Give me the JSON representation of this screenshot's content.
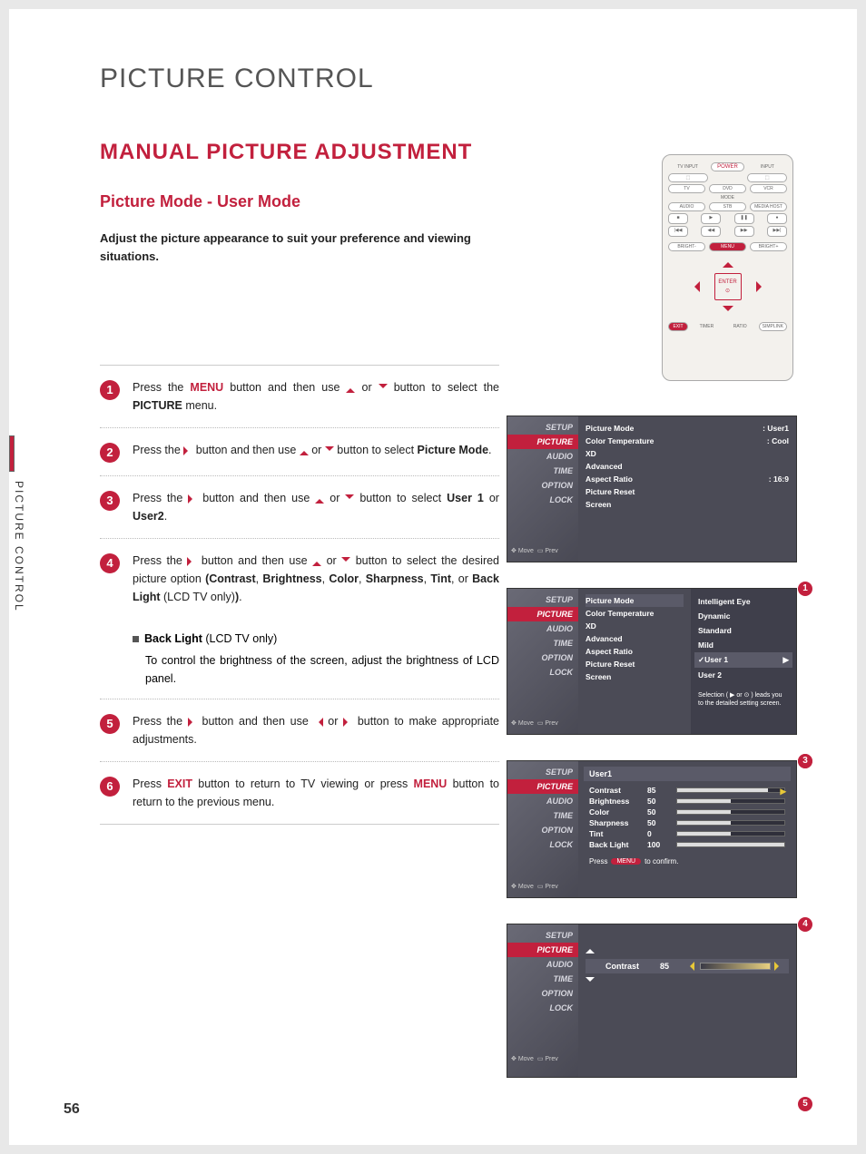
{
  "mainTitle": "PICTURE CONTROL",
  "sectionTitle": "MANUAL PICTURE ADJUSTMENT",
  "subtitle": "Picture Mode - User Mode",
  "intro": "Adjust the picture appearance to suit your preference and viewing situations.",
  "sideTab": "PICTURE CONTROL",
  "pageNumber": "56",
  "remote": {
    "tvInput": "TV INPUT",
    "input": "INPUT",
    "power": "POWER",
    "tv": "TV",
    "dvd": "DVD",
    "vcr": "VCR",
    "audio": "AUDIO",
    "stb": "STB",
    "mediaHost": "MEDIA HOST",
    "mode": "MODE",
    "brightMinus": "BRIGHT-",
    "menu": "MENU",
    "brightPlus": "BRIGHT+",
    "enter": "ENTER",
    "exit": "EXIT",
    "timer": "TIMER",
    "ratio": "RATIO",
    "simplink": "SIMPLINK"
  },
  "steps": {
    "s1a": "Press the ",
    "s1menu": "MENU",
    "s1b": " button and then use ",
    "s1c": " or ",
    "s1d": " button to select the ",
    "s1e": "PICTURE",
    "s1f": " menu.",
    "s2a": "Press the ",
    "s2b": " button and then use ",
    "s2c": " or ",
    "s2d": " button to select ",
    "s2e": "Picture Mode",
    "s2f": ".",
    "s3a": "Press the ",
    "s3b": " button and then use ",
    "s3c": " or ",
    "s3d": " button to select ",
    "s3e": "User 1",
    "s3or": " or ",
    "s3g": "User2",
    "s3h": ".",
    "s4a": "Press the ",
    "s4b": " button and then use ",
    "s4c": " or ",
    "s4d": " button to select the desired picture option ",
    "s4e": "(Contrast",
    "s4f": ", ",
    "s4g": "Brightness",
    "s4h": ", ",
    "s4i": "Color",
    "s4j": ", ",
    "s4k": "Sharpness",
    "s4l": ",  ",
    "s4m": "Tint",
    "s4n": ", or ",
    "s4o": "Back Light",
    "s4p": " (LCD TV only)",
    "s4q": ")",
    "s4r": ".",
    "noteTitle": "Back Light",
    "noteSub": " (LCD TV only)",
    "noteBody": "To control the brightness of the screen, adjust the brightness of LCD panel.",
    "s5a": "Press the ",
    "s5b": " button and then use ",
    "s5c": " or ",
    "s5d": " button to make appropriate adjustments.",
    "s6a": "Press ",
    "s6exit": "EXIT",
    "s6b": " button to return to TV viewing or press ",
    "s6menu": "MENU",
    "s6c": " button to return to the previous menu."
  },
  "osd": {
    "sideItems": [
      "SETUP",
      "PICTURE",
      "AUDIO",
      "TIME",
      "OPTION",
      "LOCK"
    ],
    "moveText": "Move",
    "prevText": "Prev",
    "panel1": {
      "rows": [
        {
          "label": "Picture Mode",
          "value": ": User1"
        },
        {
          "label": "Color Temperature",
          "value": ": Cool"
        },
        {
          "label": "XD",
          "value": ""
        },
        {
          "label": "Advanced",
          "value": ""
        },
        {
          "label": "Aspect Ratio",
          "value": ": 16:9"
        },
        {
          "label": "Picture Reset",
          "value": ""
        },
        {
          "label": "Screen",
          "value": ""
        }
      ]
    },
    "panel2": {
      "leftRows": [
        "Picture Mode",
        "Color Temperature",
        "XD",
        "Advanced",
        "Aspect Ratio",
        "Picture Reset",
        "Screen"
      ],
      "subItems": [
        "Intelligent Eye",
        "Dynamic",
        "Standard",
        "Mild"
      ],
      "selected": "User 1",
      "after": "User 2",
      "note": "Selection ( ▶ or ⊙ ) leads you to the detailed setting screen."
    },
    "panel3": {
      "title": "User1",
      "rows": [
        {
          "label": "Contrast",
          "value": "85",
          "pct": 85
        },
        {
          "label": "Brightness",
          "value": "50",
          "pct": 50
        },
        {
          "label": "Color",
          "value": "50",
          "pct": 50
        },
        {
          "label": "Sharpness",
          "value": "50",
          "pct": 50
        },
        {
          "label": "Tint",
          "value": "0",
          "pct": 50
        },
        {
          "label": "Back Light",
          "value": "100",
          "pct": 100
        }
      ],
      "footPress": "Press",
      "footBtn": "MENU",
      "footConfirm": "to confirm."
    },
    "panel4": {
      "label": "Contrast",
      "value": "85"
    }
  }
}
